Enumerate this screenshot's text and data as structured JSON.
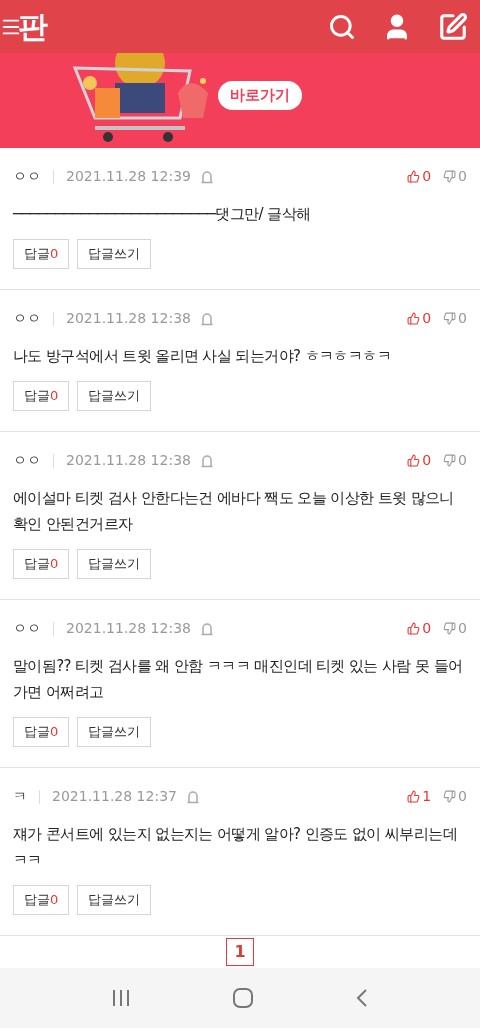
{
  "header": {
    "logo": "판"
  },
  "banner": {
    "button": "바로가기"
  },
  "comments": [
    {
      "author": "ㅇㅇ",
      "time": "2021.11.28 12:39",
      "likes": "0",
      "dislikes": "0",
      "body": "────────────────────────댓그만/ 글삭해",
      "reply_label": "답글",
      "reply_count": "0",
      "write_label": "답글쓰기"
    },
    {
      "author": "ㅇㅇ",
      "time": "2021.11.28 12:38",
      "likes": "0",
      "dislikes": "0",
      "body": "나도 방구석에서 트윗 올리면 사실 되는거야? ㅎㅋㅎㅋㅎㅋ",
      "reply_label": "답글",
      "reply_count": "0",
      "write_label": "답글쓰기"
    },
    {
      "author": "ㅇㅇ",
      "time": "2021.11.28 12:38",
      "likes": "0",
      "dislikes": "0",
      "body": "에이설마 티켓 검사 안한다는건 에바다 짹도 오늘 이상한 트윗 많으니 확인 안된건거르자",
      "reply_label": "답글",
      "reply_count": "0",
      "write_label": "답글쓰기"
    },
    {
      "author": "ㅇㅇ",
      "time": "2021.11.28 12:38",
      "likes": "0",
      "dislikes": "0",
      "body": "말이됨?? 티켓 검사를 왜 안함 ㅋㅋㅋ 매진인데 티켓 있는 사람 못 들어가면 어쩌려고",
      "reply_label": "답글",
      "reply_count": "0",
      "write_label": "답글쓰기"
    },
    {
      "author": "ㅋ",
      "time": "2021.11.28 12:37",
      "likes": "1",
      "dislikes": "0",
      "body": "쟤가 콘서트에 있는지 없는지는 어떻게 알아? 인증도 없이 씨부리는데 ㅋㅋ",
      "reply_label": "답글",
      "reply_count": "0",
      "write_label": "답글쓰기"
    }
  ],
  "pagination": [
    {
      "label": "1",
      "selected": true
    }
  ]
}
